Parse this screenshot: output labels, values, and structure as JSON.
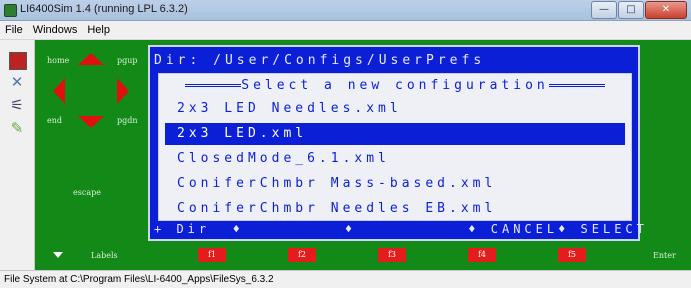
{
  "window": {
    "title": "LI6400Sim 1.4 (running LPL 6.3.2)",
    "minimize": "—",
    "maximize": "□",
    "close": "✕"
  },
  "menu": [
    "File",
    "Windows",
    "Help"
  ],
  "keypad": {
    "home": "home",
    "pgup": "pgup",
    "end": "end",
    "pgdn": "pgdn",
    "escape": "escape",
    "labels": "Labels",
    "enter": "Enter"
  },
  "screen": {
    "dir_line": "Dir: /User/Configs/UserPrefs",
    "dialog_title": "Select a new configuration",
    "files": [
      "2x3 LED Needles.xml",
      "2x3 LED.xml",
      "ClosedMode_6.1.xml",
      "ConiferChmbr Mass-based.xml",
      "ConiferChmbr Needles EB.xml"
    ],
    "selected_index": 1,
    "softkeys": "+ Dir  ♦         ♦          ♦ CANCEL♦ SELECT"
  },
  "fkeys": [
    "f1",
    "f2",
    "f3",
    "f4",
    "f5"
  ],
  "status": "File System at C:\\Program Files\\LI-6400_Apps\\FileSys_6.3.2",
  "colors": {
    "panel_green": "#138a18",
    "screen_blue": "#0a1fd6",
    "key_red": "#e41c1c"
  }
}
